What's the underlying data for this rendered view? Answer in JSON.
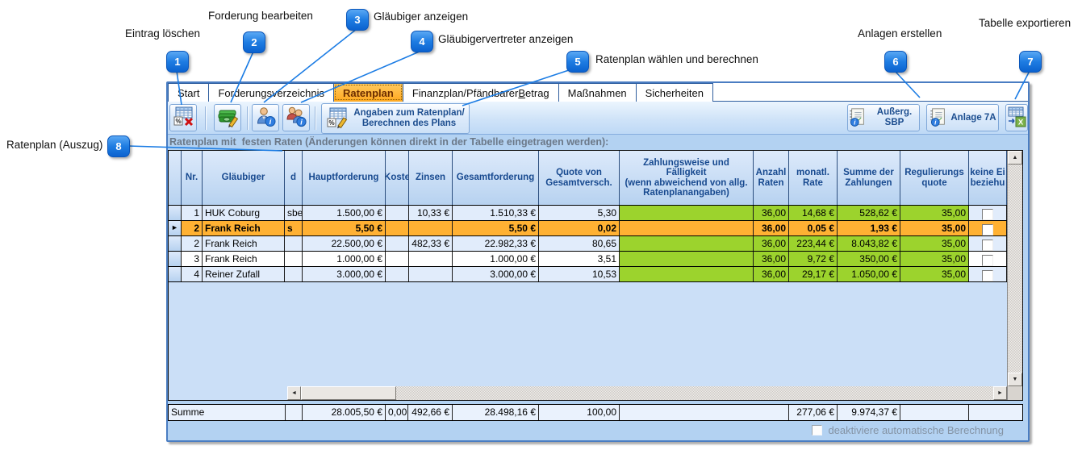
{
  "colors": {
    "selected_row": "#FFB133",
    "green_cell": "#9CD32D",
    "callout_blue": "#1B7CE4",
    "window_border": "#4A7DC2",
    "zebra_row": "#E1ECFB"
  },
  "callouts": [
    {
      "num": "1",
      "label": "Eintrag löschen"
    },
    {
      "num": "2",
      "label": "Forderung bearbeiten"
    },
    {
      "num": "3",
      "label": "Gläubiger anzeigen"
    },
    {
      "num": "4",
      "label": "Gläubigervertreter anzeigen"
    },
    {
      "num": "5",
      "label": "Ratenplan wählen und berechnen"
    },
    {
      "num": "6",
      "label": "Anlagen erstellen"
    },
    {
      "num": "7",
      "label": "Tabelle exportieren"
    },
    {
      "num": "8",
      "label": "Ratenplan (Auszug)"
    }
  ],
  "tabs": [
    {
      "id": "start",
      "label": "Start",
      "active": false
    },
    {
      "id": "forderungsverzeichnis",
      "label": "Forderungsverzeichnis",
      "active": false
    },
    {
      "id": "ratenplan",
      "label": "Ratenplan",
      "active": true
    },
    {
      "id": "finanzplan",
      "label": "Finanzplan/Pfändbarer Betrag",
      "active": false,
      "accel_split": [
        "Finanzplan/Pfändbarer ",
        "B",
        "etrag"
      ]
    },
    {
      "id": "massnahmen",
      "label": "Maßnahmen",
      "active": false
    },
    {
      "id": "sicherheiten",
      "label": "Sicherheiten",
      "active": false
    }
  ],
  "toolbar": {
    "plan_button_line1": "Angaben zum Ratenplan/",
    "plan_button_line2": "Berechnen des Plans",
    "ausserg_sbp_label": "Außerg. SBP",
    "anlage7a_label": "Anlage 7A"
  },
  "caption": "Ratenplan mit  festen Raten (Änderungen können direkt in der Tabelle eingetragen werden):",
  "grid": {
    "headers": [
      {
        "id": "row-selector",
        "lines": []
      },
      {
        "id": "nr",
        "lines": [
          "Nr."
        ]
      },
      {
        "id": "glaeubiger",
        "lines": [
          "Gläubiger"
        ]
      },
      {
        "id": "d",
        "lines": [
          "d"
        ]
      },
      {
        "id": "hauptforderung",
        "lines": [
          "Hauptforderung"
        ]
      },
      {
        "id": "kosten",
        "lines": [
          "Koste"
        ]
      },
      {
        "id": "zinsen",
        "lines": [
          "Zinsen"
        ]
      },
      {
        "id": "gesamtforderung",
        "lines": [
          "Gesamtforderung"
        ]
      },
      {
        "id": "quote",
        "lines": [
          "Quote von",
          "Gesamtversch."
        ]
      },
      {
        "id": "zahlungsweise",
        "lines": [
          "Zahlungsweise und",
          "Fälligkeit",
          "(wenn abweichend von allg.",
          "Ratenplanangaben)"
        ]
      },
      {
        "id": "anzahl-raten",
        "lines": [
          "Anzahl",
          "Raten"
        ]
      },
      {
        "id": "monatl-rate",
        "lines": [
          "monatl.",
          "Rate"
        ]
      },
      {
        "id": "summe-zahlungen",
        "lines": [
          "Summe der",
          "Zahlungen"
        ]
      },
      {
        "id": "regulierungsquote",
        "lines": [
          "Regulierungs",
          "quote"
        ]
      },
      {
        "id": "keine-einbeziehung",
        "lines": [
          "keine Ei",
          "beziehu"
        ]
      }
    ],
    "rows": [
      {
        "selected": false,
        "cells": [
          "",
          "1",
          "HUK Coburg",
          "sbei",
          "1.500,00 €",
          "",
          "10,33 €",
          "1.510,33 €",
          "5,30",
          "",
          "36,00",
          "14,68 €",
          "528,62 €",
          "35,00"
        ]
      },
      {
        "selected": true,
        "cells": [
          "►",
          "2",
          "Frank Reich",
          "s",
          "5,50 €",
          "",
          "",
          "5,50 €",
          "0,02",
          "",
          "36,00",
          "0,05 €",
          "1,93 €",
          "35,00"
        ]
      },
      {
        "selected": false,
        "cells": [
          "",
          "2",
          "Frank Reich",
          "",
          "22.500,00 €",
          "",
          "482,33 €",
          "22.982,33 €",
          "80,65",
          "",
          "36,00",
          "223,44 €",
          "8.043,82 €",
          "35,00"
        ]
      },
      {
        "selected": false,
        "cells": [
          "",
          "3",
          "Frank Reich",
          "",
          "1.000,00 €",
          "",
          "",
          "1.000,00 €",
          "3,51",
          "",
          "36,00",
          "9,72 €",
          "350,00 €",
          "35,00"
        ]
      },
      {
        "selected": false,
        "cells": [
          "",
          "4",
          "Reiner Zufall",
          "",
          "3.000,00 €",
          "",
          "",
          "3.000,00 €",
          "10,53",
          "",
          "36,00",
          "29,17 €",
          "1.050,00 €",
          "35,00"
        ]
      }
    ],
    "sum_row": [
      "Summe",
      "",
      "28.005,50 €",
      "0,00",
      "492,66 €",
      "28.498,16 €",
      "100,00",
      "",
      "277,06 €",
      "9.974,37 €",
      "",
      ""
    ]
  },
  "footer": {
    "auto_calc_label": "deaktiviere automatische Berechnung"
  },
  "icons": {
    "left": "◄",
    "right": "►",
    "up": "▲",
    "down": "▼"
  }
}
